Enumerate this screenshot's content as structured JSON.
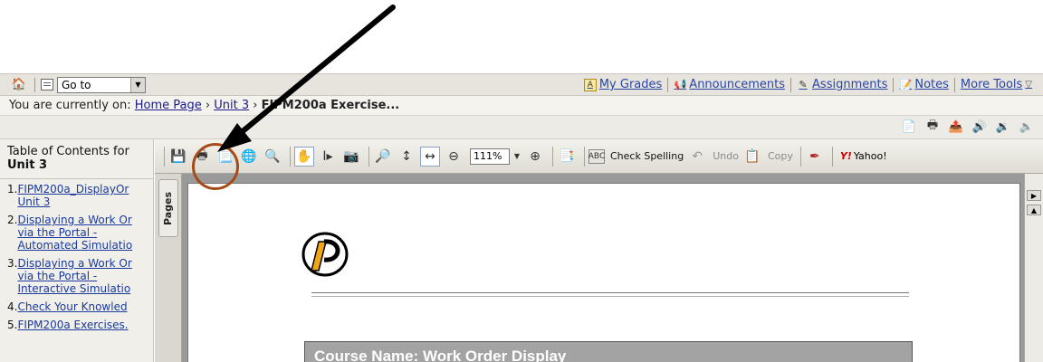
{
  "annotation": {
    "text": ""
  },
  "topbar": {
    "goto_label": "Go to",
    "tools": [
      {
        "icon": "grades-icon",
        "label": "My Grades"
      },
      {
        "icon": "announcements-icon",
        "label": "Announcements"
      },
      {
        "icon": "assignments-icon",
        "label": "Assignments"
      },
      {
        "icon": "notes-icon",
        "label": "Notes"
      }
    ],
    "more_tools": "More Tools"
  },
  "breadcrumb": {
    "prefix": "You are currently on:",
    "home": "Home Page",
    "unit": "Unit 3",
    "current": "FIPM200a Exercise..."
  },
  "toc": {
    "title": "Table of Contents for",
    "unit": "Unit 3",
    "items": [
      {
        "num": "1.",
        "lines": [
          "FIPM200a_DisplayOr",
          "Unit 3"
        ]
      },
      {
        "num": "2.",
        "lines": [
          "Displaying a Work Or",
          "via the Portal -",
          "Automated Simulatio"
        ]
      },
      {
        "num": "3.",
        "lines": [
          "Displaying a Work Or",
          "via the Portal -",
          "Interactive Simulatio"
        ]
      },
      {
        "num": "4.",
        "lines": [
          "Check Your Knowled"
        ]
      },
      {
        "num": "5.",
        "lines": [
          "FIPM200a Exercises."
        ]
      }
    ]
  },
  "pdf_toolbar": {
    "zoom": "111%",
    "check_spelling": "Check Spelling",
    "undo": "Undo",
    "copy": "Copy",
    "yahoo": "Yahoo!"
  },
  "pages_tab": "Pages",
  "document": {
    "course_title": "Course Name: Work Order Display"
  },
  "colors": {
    "circle": "#a64a17",
    "arrow": "#000000",
    "link": "#2a46a8"
  }
}
